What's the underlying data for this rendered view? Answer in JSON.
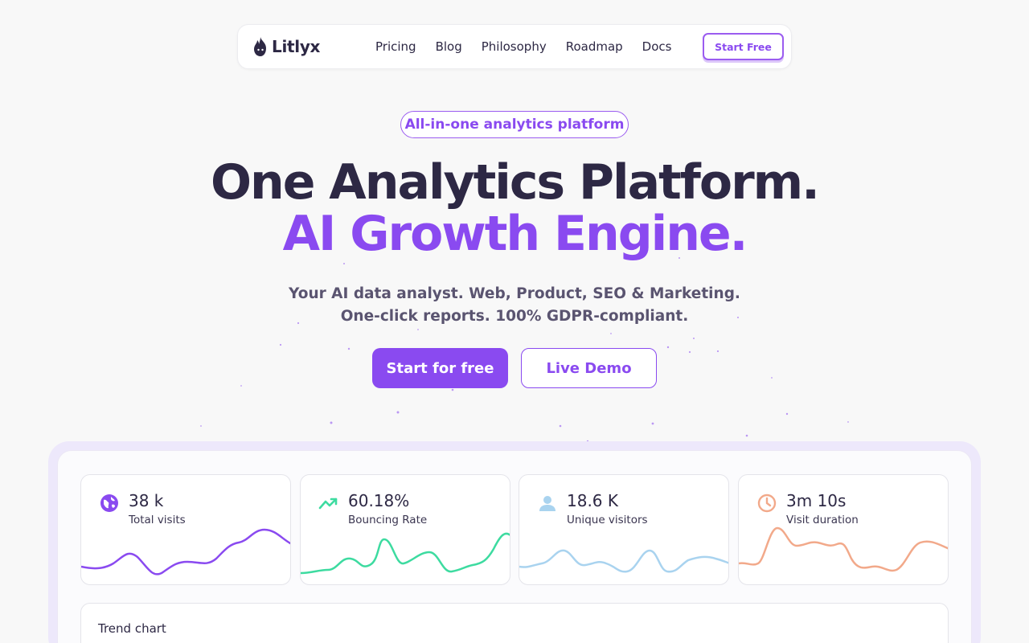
{
  "nav": {
    "logo_text": "Litlyx",
    "links": [
      "Pricing",
      "Blog",
      "Philosophy",
      "Roadmap",
      "Docs"
    ],
    "cta": "Start Free"
  },
  "hero": {
    "badge": "All-in-one analytics platform",
    "title_line1": "One Analytics Platform.",
    "title_line2": "AI Growth Engine.",
    "subtitle": "Your AI data analyst. Web, Product, SEO & Marketing. One-click reports. 100% GDPR-compliant.",
    "primary_button": "Start for free",
    "secondary_button": "Live Demo"
  },
  "dashboard": {
    "cards": [
      {
        "value": "38 k",
        "label": "Total visits",
        "icon": "globe-icon",
        "color": "#8a4af0"
      },
      {
        "value": "60.18%",
        "label": "Bouncing Rate",
        "icon": "trending-up-icon",
        "color": "#3ddba0"
      },
      {
        "value": "18.6 K",
        "label": "Unique visitors",
        "icon": "user-icon",
        "color": "#a9d3ef"
      },
      {
        "value": "3m 10s",
        "label": "Visit duration",
        "icon": "clock-icon",
        "color": "#f2a98a"
      }
    ],
    "trend_title": "Trend chart"
  },
  "colors": {
    "accent": "#8a4af0",
    "text": "#2d2844",
    "background": "#f8f8f8"
  }
}
